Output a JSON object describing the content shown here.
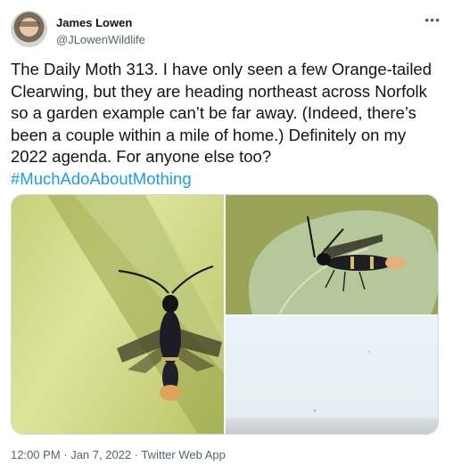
{
  "author": {
    "name": "James Lowen",
    "handle": "@JLowenWildlife"
  },
  "more_icon": "more-horizontal-icon",
  "tweet": {
    "text": "The Daily Moth 313. I have only seen a few Orange-tailed Clearwing, but they are heading northeast across Norfolk so a garden example can’t be far away. (Indeed, there’s been a couple within a mile of home.) Definitely on my 2022 agenda. For anyone else too? ",
    "hashtag": "#MuchAdoAboutMothing"
  },
  "footer": {
    "meta": "12:00 PM · Jan 7, 2022 · Twitter Web App"
  }
}
